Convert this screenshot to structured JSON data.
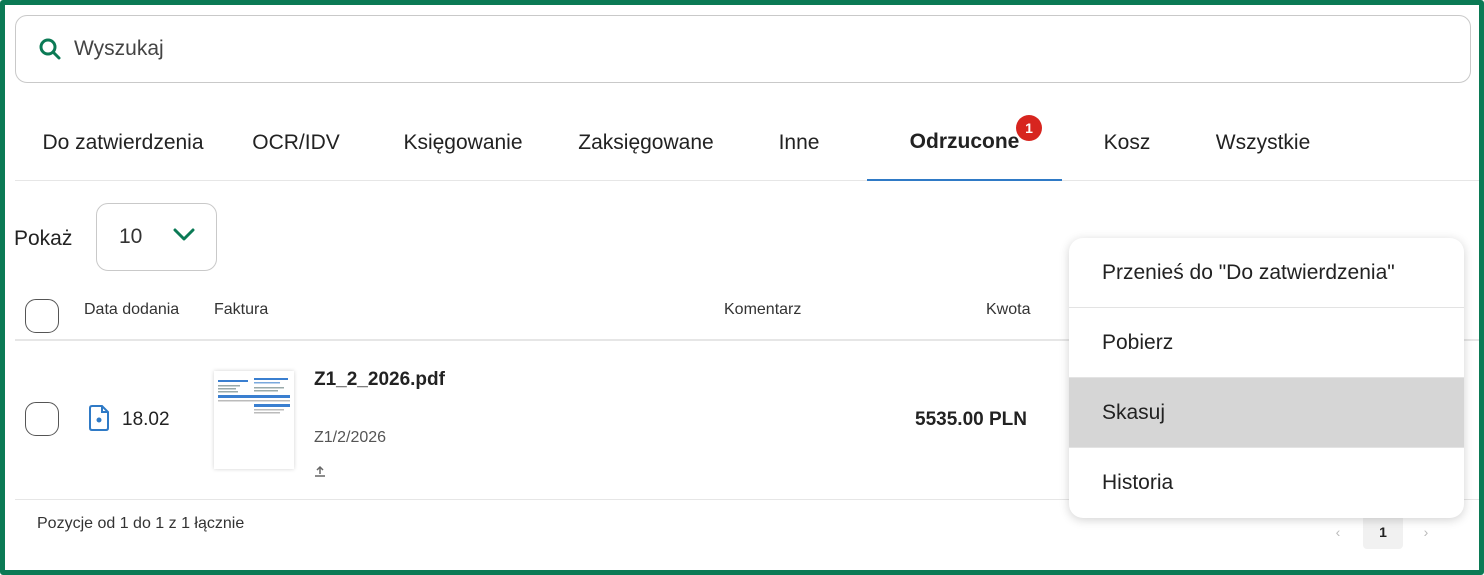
{
  "search": {
    "placeholder": "Wyszukaj"
  },
  "tabs": [
    {
      "label": "Do zatwierdzenia"
    },
    {
      "label": "OCR/IDV"
    },
    {
      "label": "Księgowanie"
    },
    {
      "label": "Zaksięgowane"
    },
    {
      "label": "Inne"
    },
    {
      "label": "Odrzucone",
      "active": true,
      "badge": "1"
    },
    {
      "label": "Kosz"
    },
    {
      "label": "Wszystkie"
    }
  ],
  "show": {
    "label": "Pokaż",
    "page_size": "10"
  },
  "table": {
    "headers": {
      "date": "Data dodania",
      "invoice": "Faktura",
      "comment": "Komentarz",
      "amount": "Kwota"
    },
    "rows": [
      {
        "date": "18.02",
        "file_name": "Z1_2_2026.pdf",
        "invoice_number": "Z1/2/2026",
        "amount": "5535.00 PLN"
      }
    ]
  },
  "footer": {
    "summary": "Pozycje od 1 do 1 z 1 łącznie",
    "prev": "‹",
    "page": "1",
    "next": "›"
  },
  "context_menu": {
    "items": [
      {
        "label": "Przenieś do \"Do zatwierdzenia\""
      },
      {
        "label": "Pobierz"
      },
      {
        "label": "Skasuj",
        "highlighted": true
      },
      {
        "label": "Historia"
      }
    ]
  },
  "colors": {
    "frame": "#0b7a55",
    "accent_icon": "#0b7a55",
    "active_tab_underline": "#2f7ac6",
    "badge": "#d7251f",
    "file_icon": "#2f7ac6"
  }
}
